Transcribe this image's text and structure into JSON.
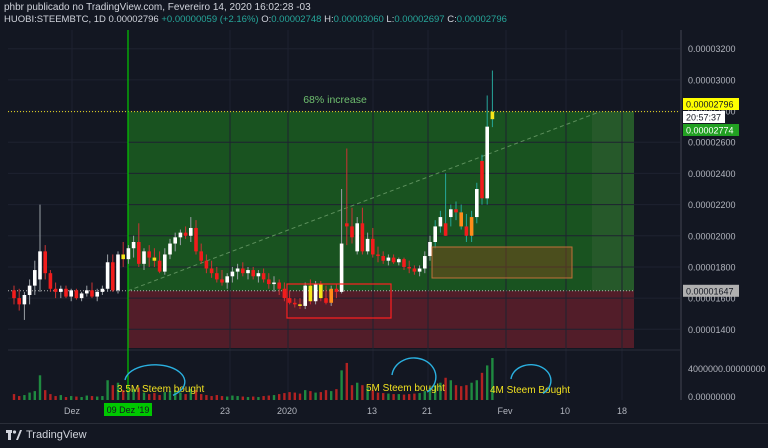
{
  "header": {
    "line1": "phbr publicado no TradingView.com, Fevereiro 14, 2020 16:02:28 -03",
    "symbol": "HUOBI:STEEMBTC, 1D",
    "last": "0.00002796",
    "change": "+0.00000059 (+2.16%)",
    "o_label": "O:",
    "o": "0.00002748",
    "h_label": "H:",
    "h": "0.00003060",
    "l_label": "L:",
    "l": "0.00002697",
    "c_label": "C:",
    "c": "0.00002796"
  },
  "footer": {
    "brand": "TradingView"
  },
  "chart_data": {
    "type": "candlestick",
    "y_axis": {
      "ticks": [
        "0.00003200",
        "0.00003000",
        "0.00002800",
        "0.00002600",
        "0.00002400",
        "0.00002200",
        "0.00002000",
        "0.00001800",
        "0.00001600",
        "0.00001400"
      ],
      "tick_values": [
        3.2e-05,
        3e-05,
        2.8e-05,
        2.6e-05,
        2.4e-05,
        2.2e-05,
        2e-05,
        1.8e-05,
        1.6e-05,
        1.4e-05
      ],
      "range": [
        1.28e-05,
        3.32e-05
      ]
    },
    "x_axis": {
      "ticks": [
        "Dez",
        "23",
        "2020",
        "13",
        "21",
        "Fev",
        "10",
        "18"
      ]
    },
    "volume_axis": {
      "ticks": [
        "4000000.00000000",
        "0.00000000"
      ]
    },
    "price_labels": {
      "last": "0.00002796",
      "countdown": "20:57:37",
      "ma": "0.00002774",
      "entry": "0.00001647"
    },
    "vertical_marker_label": "09 Dez '19",
    "annotations": {
      "increase": "68% increase",
      "buy1": "3.5M Steem bought",
      "buy2": "5M Steem bought",
      "buy3": "4M Steem Bought"
    },
    "colors": {
      "up": "#ffffff",
      "down": "#f21c1c",
      "highlight_up": "#f5e51b",
      "highlight_down": "#ff8c1a",
      "gain_zone": "#1b5e20",
      "loss_zone": "#5a1e2a",
      "marker": "#00c800"
    },
    "candles": [
      {
        "o": 1.65e-05,
        "h": 1.68e-05,
        "l": 1.56e-05,
        "c": 1.6e-05
      },
      {
        "o": 1.6e-05,
        "h": 1.66e-05,
        "l": 1.52e-05,
        "c": 1.56e-05
      },
      {
        "o": 1.56e-05,
        "h": 1.64e-05,
        "l": 1.46e-05,
        "c": 1.62e-05
      },
      {
        "o": 1.62e-05,
        "h": 1.72e-05,
        "l": 1.56e-05,
        "c": 1.68e-05
      },
      {
        "o": 1.68e-05,
        "h": 1.84e-05,
        "l": 1.62e-05,
        "c": 1.78e-05
      },
      {
        "o": 1.72e-05,
        "h": 2.2e-05,
        "l": 1.64e-05,
        "c": 1.9e-05
      },
      {
        "o": 1.9e-05,
        "h": 1.94e-05,
        "l": 1.72e-05,
        "c": 1.76e-05
      },
      {
        "o": 1.76e-05,
        "h": 1.78e-05,
        "l": 1.64e-05,
        "c": 1.66e-05
      },
      {
        "o": 1.66e-05,
        "h": 1.7e-05,
        "l": 1.6e-05,
        "c": 1.64e-05
      },
      {
        "o": 1.64e-05,
        "h": 1.68e-05,
        "l": 1.6e-05,
        "c": 1.66e-05
      },
      {
        "o": 1.66e-05,
        "h": 1.68e-05,
        "l": 1.6e-05,
        "c": 1.61e-05
      },
      {
        "o": 1.61e-05,
        "h": 1.66e-05,
        "l": 1.58e-05,
        "c": 1.65e-05
      },
      {
        "o": 1.65e-05,
        "h": 1.66e-05,
        "l": 1.59e-05,
        "c": 1.6e-05
      },
      {
        "o": 1.6e-05,
        "h": 1.64e-05,
        "l": 1.58e-05,
        "c": 1.63e-05
      },
      {
        "o": 1.63e-05,
        "h": 1.68e-05,
        "l": 1.61e-05,
        "c": 1.65e-05
      },
      {
        "o": 1.65e-05,
        "h": 1.7e-05,
        "l": 1.6e-05,
        "c": 1.61e-05
      },
      {
        "o": 1.61e-05,
        "h": 1.66e-05,
        "l": 1.58e-05,
        "c": 1.64e-05
      },
      {
        "o": 1.64e-05,
        "h": 1.68e-05,
        "l": 1.62e-05,
        "c": 1.66e-05
      },
      {
        "o": 1.66e-05,
        "h": 1.88e-05,
        "l": 1.64e-05,
        "c": 1.83e-05
      },
      {
        "o": 1.83e-05,
        "h": 1.88e-05,
        "l": 1.64e-05,
        "c": 1.65e-05
      },
      {
        "o": 1.65e-05,
        "h": 1.9e-05,
        "l": 1.63e-05,
        "c": 1.88e-05
      },
      {
        "o": 1.88e-05,
        "h": 1.96e-05,
        "l": 1.8e-05,
        "c": 1.85e-05
      },
      {
        "o": 1.85e-05,
        "h": 1.94e-05,
        "l": 1.82e-05,
        "c": 1.92e-05
      },
      {
        "o": 1.92e-05,
        "h": 2e-05,
        "l": 1.86e-05,
        "c": 1.96e-05
      },
      {
        "o": 1.96e-05,
        "h": 2.08e-05,
        "l": 1.8e-05,
        "c": 1.82e-05
      },
      {
        "o": 1.82e-05,
        "h": 1.92e-05,
        "l": 1.78e-05,
        "c": 1.9e-05
      },
      {
        "o": 1.9e-05,
        "h": 1.94e-05,
        "l": 1.8e-05,
        "c": 1.86e-05
      },
      {
        "o": 1.86e-05,
        "h": 1.92e-05,
        "l": 1.8e-05,
        "c": 1.84e-05
      },
      {
        "o": 1.84e-05,
        "h": 1.9e-05,
        "l": 1.76e-05,
        "c": 1.77e-05
      },
      {
        "o": 1.77e-05,
        "h": 1.92e-05,
        "l": 1.75e-05,
        "c": 1.88e-05
      },
      {
        "o": 1.88e-05,
        "h": 1.98e-05,
        "l": 1.85e-05,
        "c": 1.95e-05
      },
      {
        "o": 1.95e-05,
        "h": 2.02e-05,
        "l": 1.9e-05,
        "c": 1.99e-05
      },
      {
        "o": 1.99e-05,
        "h": 2.04e-05,
        "l": 1.94e-05,
        "c": 2.02e-05
      },
      {
        "o": 2.02e-05,
        "h": 2.06e-05,
        "l": 1.98e-05,
        "c": 2e-05
      },
      {
        "o": 2e-05,
        "h": 2.12e-05,
        "l": 1.96e-05,
        "c": 2.05e-05
      },
      {
        "o": 2.05e-05,
        "h": 2.1e-05,
        "l": 1.88e-05,
        "c": 1.9e-05
      },
      {
        "o": 1.9e-05,
        "h": 1.95e-05,
        "l": 1.82e-05,
        "c": 1.84e-05
      },
      {
        "o": 1.84e-05,
        "h": 1.88e-05,
        "l": 1.76e-05,
        "c": 1.79e-05
      },
      {
        "o": 1.79e-05,
        "h": 1.84e-05,
        "l": 1.73e-05,
        "c": 1.76e-05
      },
      {
        "o": 1.76e-05,
        "h": 1.8e-05,
        "l": 1.7e-05,
        "c": 1.72e-05
      },
      {
        "o": 1.72e-05,
        "h": 1.78e-05,
        "l": 1.68e-05,
        "c": 1.7e-05
      },
      {
        "o": 1.7e-05,
        "h": 1.76e-05,
        "l": 1.66e-05,
        "c": 1.74e-05
      },
      {
        "o": 1.74e-05,
        "h": 1.8e-05,
        "l": 1.7e-05,
        "c": 1.77e-05
      },
      {
        "o": 1.77e-05,
        "h": 1.82e-05,
        "l": 1.72e-05,
        "c": 1.79e-05
      },
      {
        "o": 1.79e-05,
        "h": 1.83e-05,
        "l": 1.74e-05,
        "c": 1.76e-05
      },
      {
        "o": 1.76e-05,
        "h": 1.8e-05,
        "l": 1.72e-05,
        "c": 1.78e-05
      },
      {
        "o": 1.78e-05,
        "h": 1.8e-05,
        "l": 1.72e-05,
        "c": 1.74e-05
      },
      {
        "o": 1.74e-05,
        "h": 1.78e-05,
        "l": 1.7e-05,
        "c": 1.76e-05
      },
      {
        "o": 1.76e-05,
        "h": 1.79e-05,
        "l": 1.7e-05,
        "c": 1.72e-05
      },
      {
        "o": 1.72e-05,
        "h": 1.76e-05,
        "l": 1.66e-05,
        "c": 1.69e-05
      },
      {
        "o": 1.69e-05,
        "h": 1.74e-05,
        "l": 1.64e-05,
        "c": 1.7e-05
      },
      {
        "o": 1.7e-05,
        "h": 1.72e-05,
        "l": 1.62e-05,
        "c": 1.66e-05
      },
      {
        "o": 1.66e-05,
        "h": 1.7e-05,
        "l": 1.58e-05,
        "c": 1.6e-05
      },
      {
        "o": 1.6e-05,
        "h": 1.65e-05,
        "l": 1.56e-05,
        "c": 1.57e-05
      },
      {
        "o": 1.57e-05,
        "h": 1.6e-05,
        "l": 1.54e-05,
        "c": 1.56e-05
      },
      {
        "o": 1.56e-05,
        "h": 1.6e-05,
        "l": 1.53e-05,
        "c": 1.55e-05
      },
      {
        "o": 1.55e-05,
        "h": 1.7e-05,
        "l": 1.53e-05,
        "c": 1.68e-05
      },
      {
        "o": 1.68e-05,
        "h": 1.72e-05,
        "l": 1.56e-05,
        "c": 1.58e-05
      },
      {
        "o": 1.58e-05,
        "h": 1.71e-05,
        "l": 1.56e-05,
        "c": 1.69e-05
      },
      {
        "o": 1.69e-05,
        "h": 1.71e-05,
        "l": 1.58e-05,
        "c": 1.6e-05
      },
      {
        "o": 1.6e-05,
        "h": 1.68e-05,
        "l": 1.56e-05,
        "c": 1.57e-05
      },
      {
        "o": 1.57e-05,
        "h": 1.68e-05,
        "l": 1.55e-05,
        "c": 1.66e-05
      },
      {
        "o": 1.66e-05,
        "h": 1.69e-05,
        "l": 1.6e-05,
        "c": 1.64e-05
      },
      {
        "o": 1.64e-05,
        "h": 2.3e-05,
        "l": 1.63e-05,
        "c": 1.95e-05
      },
      {
        "o": 2.08e-05,
        "h": 2.56e-05,
        "l": 1.94e-05,
        "c": 2.06e-05
      },
      {
        "o": 2.06e-05,
        "h": 2.18e-05,
        "l": 1.95e-05,
        "c": 1.99e-05
      },
      {
        "o": 1.9e-05,
        "h": 2.12e-05,
        "l": 1.88e-05,
        "c": 2.08e-05
      },
      {
        "o": 2.08e-05,
        "h": 2.18e-05,
        "l": 1.88e-05,
        "c": 1.9e-05
      },
      {
        "o": 1.9e-05,
        "h": 2.02e-05,
        "l": 1.88e-05,
        "c": 1.98e-05
      },
      {
        "o": 1.98e-05,
        "h": 2.05e-05,
        "l": 1.86e-05,
        "c": 1.88e-05
      },
      {
        "o": 1.88e-05,
        "h": 1.93e-05,
        "l": 1.83e-05,
        "c": 1.87e-05
      },
      {
        "o": 1.87e-05,
        "h": 1.9e-05,
        "l": 1.82e-05,
        "c": 1.84e-05
      },
      {
        "o": 1.84e-05,
        "h": 1.88e-05,
        "l": 1.81e-05,
        "c": 1.86e-05
      },
      {
        "o": 1.86e-05,
        "h": 1.88e-05,
        "l": 1.82e-05,
        "c": 1.83e-05
      },
      {
        "o": 1.83e-05,
        "h": 1.86e-05,
        "l": 1.81e-05,
        "c": 1.85e-05
      },
      {
        "o": 1.85e-05,
        "h": 1.86e-05,
        "l": 1.78e-05,
        "c": 1.8e-05
      },
      {
        "o": 1.8e-05,
        "h": 1.84e-05,
        "l": 1.76e-05,
        "c": 1.79e-05
      },
      {
        "o": 1.79e-05,
        "h": 1.81e-05,
        "l": 1.75e-05,
        "c": 1.77e-05
      },
      {
        "o": 1.77e-05,
        "h": 1.81e-05,
        "l": 1.74e-05,
        "c": 1.79e-05
      },
      {
        "o": 1.79e-05,
        "h": 1.9e-05,
        "l": 1.76e-05,
        "c": 1.87e-05
      },
      {
        "o": 1.87e-05,
        "h": 2e-05,
        "l": 1.84e-05,
        "c": 1.96e-05
      },
      {
        "o": 1.96e-05,
        "h": 2.1e-05,
        "l": 1.92e-05,
        "c": 2.06e-05
      },
      {
        "o": 2.06e-05,
        "h": 2.16e-05,
        "l": 2.02e-05,
        "c": 2.12e-05
      },
      {
        "o": 2.08e-05,
        "h": 2.4e-05,
        "l": 2e-05,
        "c": 2e-05
      },
      {
        "o": 2.12e-05,
        "h": 2.2e-05,
        "l": 2.06e-05,
        "c": 2.17e-05
      },
      {
        "o": 2.17e-05,
        "h": 2.22e-05,
        "l": 2.1e-05,
        "c": 2.15e-05
      },
      {
        "o": 2.15e-05,
        "h": 2.2e-05,
        "l": 2.04e-05,
        "c": 2.06e-05
      },
      {
        "o": 2.06e-05,
        "h": 2.14e-05,
        "l": 1.96e-05,
        "c": 2e-05
      },
      {
        "o": 2e-05,
        "h": 2.16e-05,
        "l": 1.96e-05,
        "c": 2.12e-05
      },
      {
        "o": 2.12e-05,
        "h": 2.34e-05,
        "l": 2.08e-05,
        "c": 2.3e-05
      },
      {
        "o": 2.48e-05,
        "h": 2.52e-05,
        "l": 2.2e-05,
        "c": 2.24e-05
      },
      {
        "o": 2.24e-05,
        "h": 2.9e-05,
        "l": 2.2e-05,
        "c": 2.7e-05
      },
      {
        "o": 2.748e-05,
        "h": 3.06e-05,
        "l": 2.697e-05,
        "c": 2.796e-05
      }
    ],
    "volume": [
      0.12,
      0.08,
      0.1,
      0.15,
      0.18,
      0.5,
      0.2,
      0.12,
      0.08,
      0.1,
      0.06,
      0.08,
      0.07,
      0.06,
      0.09,
      0.08,
      0.07,
      0.08,
      0.4,
      0.3,
      0.35,
      0.2,
      0.18,
      0.22,
      0.25,
      0.15,
      0.12,
      0.14,
      0.1,
      0.16,
      0.18,
      0.2,
      0.15,
      0.12,
      0.22,
      0.2,
      0.12,
      0.1,
      0.08,
      0.1,
      0.08,
      0.07,
      0.09,
      0.08,
      0.07,
      0.06,
      0.07,
      0.06,
      0.08,
      0.09,
      0.1,
      0.12,
      0.14,
      0.16,
      0.15,
      0.13,
      0.2,
      0.18,
      0.15,
      0.16,
      0.2,
      0.18,
      0.22,
      0.6,
      0.75,
      0.3,
      0.35,
      0.3,
      0.25,
      0.2,
      0.15,
      0.14,
      0.13,
      0.12,
      0.12,
      0.11,
      0.12,
      0.13,
      0.14,
      0.18,
      0.25,
      0.3,
      0.35,
      0.45,
      0.4,
      0.3,
      0.28,
      0.3,
      0.35,
      0.4,
      0.55,
      0.7,
      0.85
    ]
  }
}
